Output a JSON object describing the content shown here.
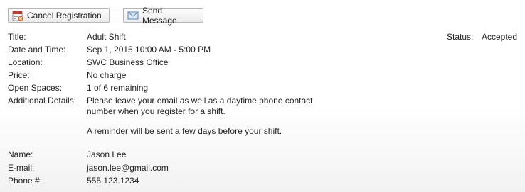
{
  "toolbar": {
    "cancel_label": "Cancel Registration",
    "send_label": "Send Message"
  },
  "details": {
    "title_label": "Title:",
    "title_value": "Adult Shift",
    "datetime_label": "Date and Time:",
    "datetime_value": "Sep 1, 2015 10:00 AM - 5:00 PM",
    "location_label": "Location:",
    "location_value": "SWC Business Office",
    "price_label": "Price:",
    "price_value": "No charge",
    "spaces_label": "Open Spaces:",
    "spaces_value": "1 of 6 remaining",
    "additional_label": "Additional Details:",
    "additional_p1": "Please leave your email as well as a daytime phone contact number when you register for a shift.",
    "additional_p2": "A reminder will be sent a few days before your shift.",
    "name_label": "Name:",
    "name_value": "Jason Lee",
    "email_label": "E-mail:",
    "email_value": "jason.lee@gmail.com",
    "phone_label": "Phone #:",
    "phone_value": "555.123.1234"
  },
  "status": {
    "label": "Status:",
    "value": "Accepted"
  },
  "icons": {
    "cancel": "calendar-cancel-icon",
    "send": "envelope-icon"
  }
}
